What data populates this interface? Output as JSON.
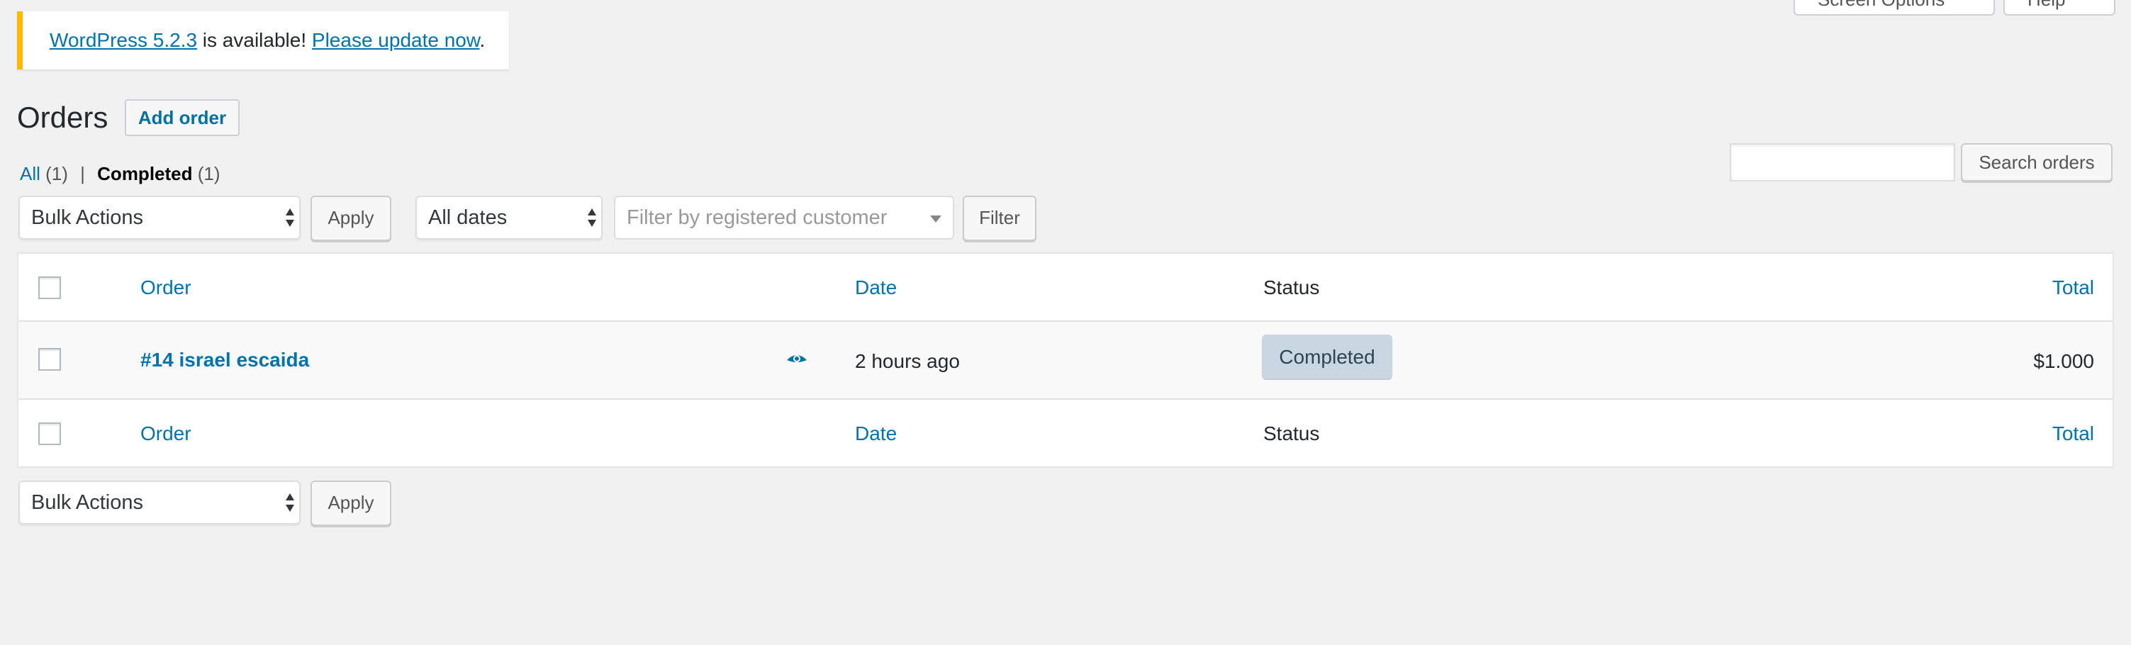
{
  "screen_meta": {
    "screen_options_label": "Screen Options",
    "help_label": "Help"
  },
  "notice": {
    "version_link": "WordPress 5.2.3",
    "middle_text": " is available! ",
    "update_link": "Please update now",
    "end_text": ".",
    "accent_color": "#ffb900"
  },
  "heading": {
    "title": "Orders",
    "add_button": "Add order"
  },
  "views": [
    {
      "label": "All",
      "count": "(1)",
      "current": false
    },
    {
      "label": "Completed",
      "count": "(1)",
      "current": true
    }
  ],
  "views_separator": "|",
  "search": {
    "placeholder": "",
    "button_label": "Search orders"
  },
  "filters": {
    "bulk_actions_selected": "Bulk Actions",
    "apply_label": "Apply",
    "dates_selected": "All dates",
    "customer_placeholder": "Filter by registered customer",
    "filter_label": "Filter"
  },
  "table": {
    "columns": {
      "order": "Order",
      "date": "Date",
      "status": "Status",
      "total": "Total"
    },
    "rows": [
      {
        "order": "#14 israel escaida",
        "preview_icon": "eye-icon",
        "date": "2 hours ago",
        "status": "Completed",
        "total": "$1.000"
      }
    ]
  },
  "bottom": {
    "bulk_actions_selected": "Bulk Actions",
    "apply_label": "Apply"
  },
  "colors": {
    "link": "#0073aa",
    "status_completed_bg": "#c8d7e1",
    "status_completed_text": "#2e4453",
    "background": "#f1f1f1"
  }
}
